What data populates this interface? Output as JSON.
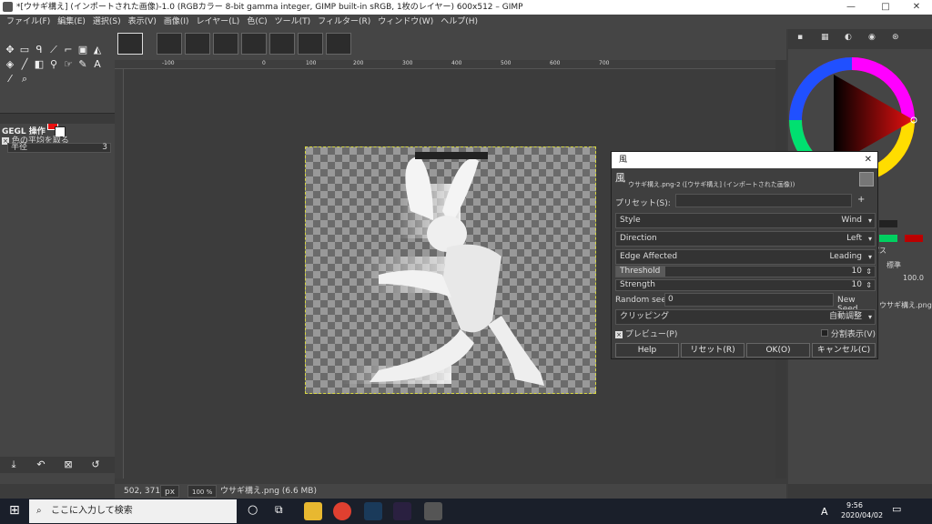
{
  "window": {
    "title": "*[ウサギ構え] (インポートされた画像)-1.0 (RGBカラー 8-bit gamma integer, GIMP built-in sRGB, 1枚のレイヤー) 600x512 – GIMP",
    "minimize": "—",
    "maximize": "□",
    "close": "✕"
  },
  "menu": [
    "ファイル(F)",
    "編集(E)",
    "選択(S)",
    "表示(V)",
    "画像(I)",
    "レイヤー(L)",
    "色(C)",
    "ツール(T)",
    "フィルター(R)",
    "ウィンドウ(W)",
    "ヘルプ(H)"
  ],
  "toolbox": {
    "panel_title": "GEGL 操作",
    "option_label": "色の平均を取る",
    "radius_label": "半径",
    "radius_value": "3"
  },
  "ruler_marks": [
    "-100",
    "0",
    "100",
    "200",
    "300",
    "400",
    "500",
    "600",
    "700"
  ],
  "status": {
    "coords": "502, 371",
    "unit": "px",
    "zoom": "100 %",
    "file": "ウサギ構え.png (6.6 MB)"
  },
  "right_dock": {
    "mode": "標準",
    "opacity": "100.0",
    "layer_name": "ウサギ構え.png",
    "paths_tab": "パス"
  },
  "dialog": {
    "title": "風",
    "header_title": "風",
    "header_sub": "ウサギ構え.png-2 ([ウサギ構え] (インポートされた画像))",
    "preset_label": "プリセット(S):",
    "style_label": "Style",
    "style_value": "Wind",
    "direction_label": "Direction",
    "direction_value": "Left",
    "edge_label": "Edge Affected",
    "edge_value": "Leading",
    "threshold_label": "Threshold",
    "threshold_value": "10",
    "strength_label": "Strength",
    "strength_value": "10",
    "seed_label": "Random seed",
    "seed_value": "0",
    "new_seed": "New Seed",
    "clipping_label": "クリッピング",
    "clipping_value": "自動調整",
    "preview_label": "プレビュー(P)",
    "split_label": "分割表示(V)",
    "help_btn": "Help",
    "reset_btn": "リセット(R)",
    "ok_btn": "OK(O)",
    "cancel_btn": "キャンセル(C)"
  },
  "taskbar": {
    "search_placeholder": "ここに入力して検索",
    "time": "9:56",
    "date": "2020/04/02",
    "ime": "A"
  },
  "colors": {
    "foreground": "#e81010",
    "background": "#ffffff",
    "accent": "#4a90d9"
  }
}
